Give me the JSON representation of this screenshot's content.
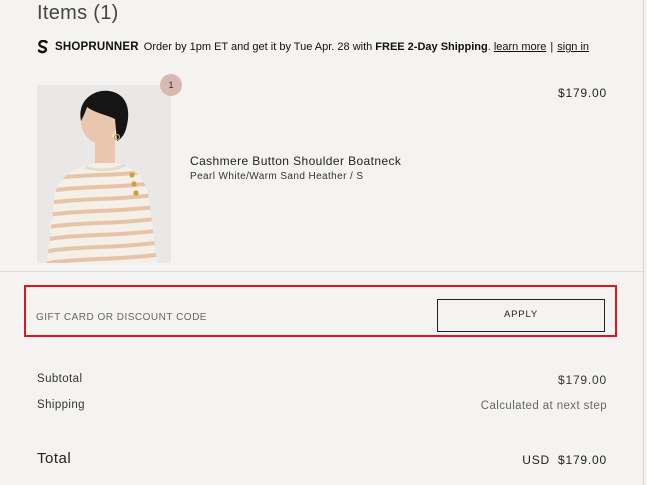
{
  "cart": {
    "title": "Items (1)"
  },
  "shoprunner": {
    "icon": "shoprunner-logo-icon",
    "brand": "SHOPRUNNER",
    "text_before": "Order by 1pm ET and get it by Tue Apr. 28 with",
    "bold_text": "FREE 2-Day Shipping",
    "punct": ".",
    "learn_more": "learn more",
    "separator": "|",
    "sign_in": "sign in"
  },
  "item": {
    "quantity": "1",
    "price": "$179.00",
    "name": "Cashmere Button Shoulder Boatneck",
    "variant": "Pearl White/Warm Sand Heather / S",
    "colors": {
      "stripe": "#e7c4a8",
      "knit": "#f4efe7",
      "button": "#c9a23e",
      "hair": "#151515",
      "skin": "#e8c7ae"
    }
  },
  "discount": {
    "placeholder": "GIFT CARD OR DISCOUNT CODE",
    "apply_label": "APPLY",
    "highlight_color": "#e0161d"
  },
  "summary": {
    "subtotal_label": "Subtotal",
    "subtotal_value": "$179.00",
    "shipping_label": "Shipping",
    "shipping_value": "Calculated at next step",
    "total_label": "Total",
    "total_currency": "USD",
    "total_value": "$179.00"
  }
}
